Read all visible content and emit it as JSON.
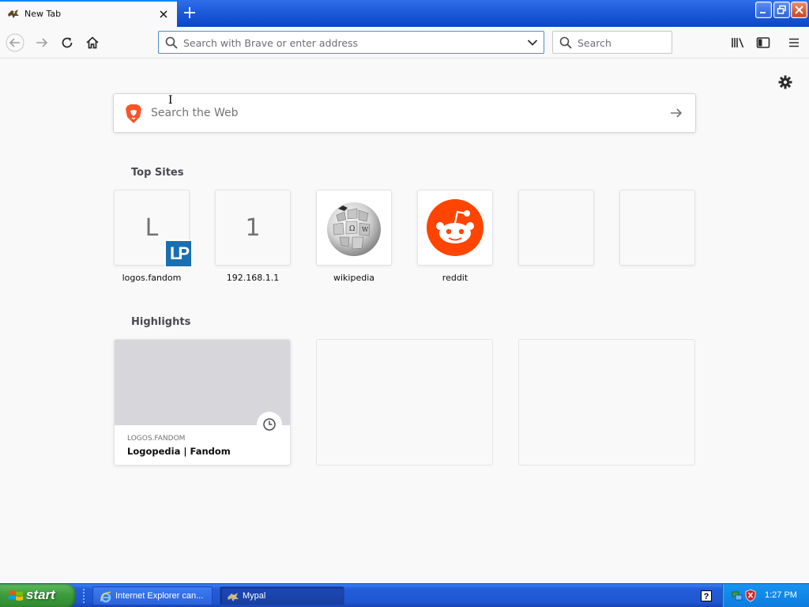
{
  "browser": {
    "tab": {
      "title": "New Tab"
    },
    "urlbar": {
      "placeholder": "Search with Brave or enter address"
    },
    "searchbar": {
      "placeholder": "Search"
    }
  },
  "content": {
    "web_search": {
      "placeholder": "Search the Web"
    },
    "top_sites": {
      "title": "Top Sites",
      "items": [
        {
          "label": "logos.fandom",
          "letter": "L",
          "badge": "LP"
        },
        {
          "label": "192.168.1.1",
          "letter": "1"
        },
        {
          "label": "wikipedia",
          "icon": "wikipedia-globe-icon"
        },
        {
          "label": "reddit",
          "icon": "reddit-icon"
        }
      ]
    },
    "highlights": {
      "title": "Highlights",
      "items": [
        {
          "host": "LOGOS.FANDOM",
          "title": "Logopedia | Fandom"
        }
      ]
    }
  },
  "taskbar": {
    "start_label": "start",
    "tasks": [
      {
        "label": "Internet Explorer can...",
        "icon": "ie-icon"
      },
      {
        "label": "Mypal",
        "icon": "mypal-icon"
      }
    ],
    "clock": "1:27 PM"
  },
  "colors": {
    "accent": "#0a84ff",
    "reddit": "#ff4500",
    "brave": "#fb542b",
    "xp_blue": "#245edb",
    "xp_green": "#3c9c3c"
  }
}
